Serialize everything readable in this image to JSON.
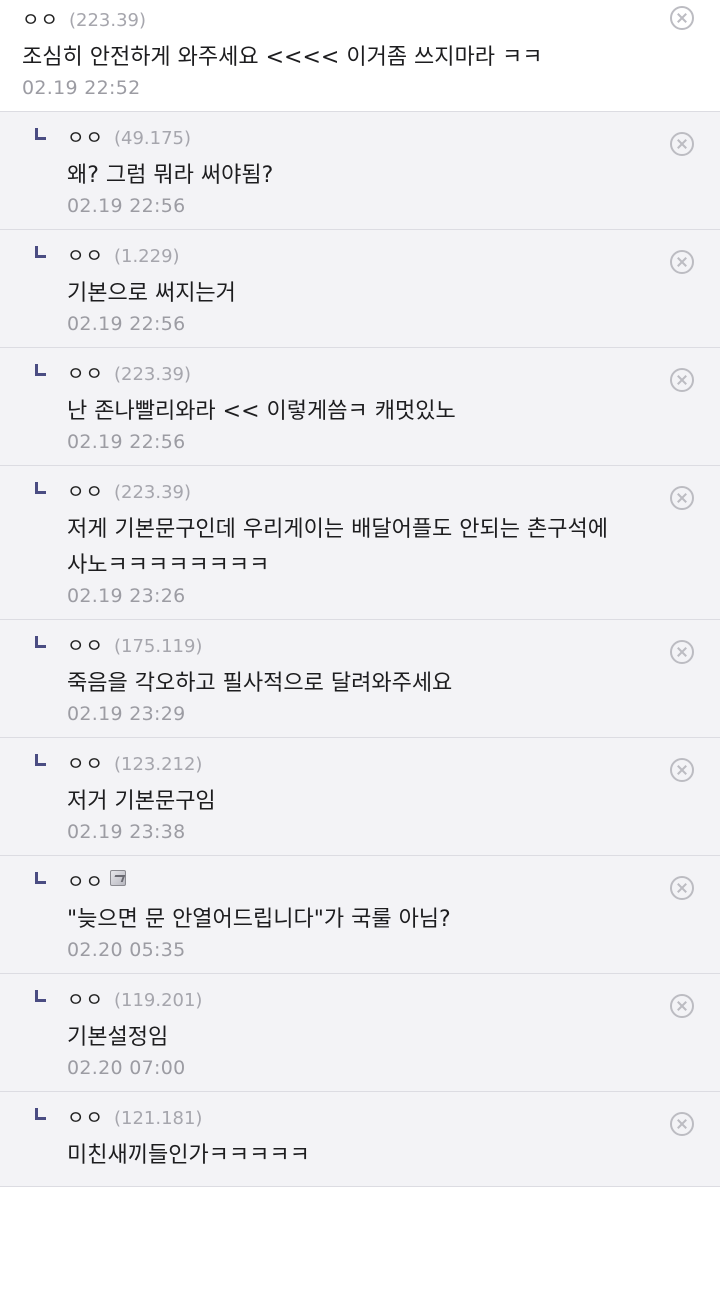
{
  "comments": [
    {
      "nick": "ㅇㅇ",
      "ip": "(223.39)",
      "text": "조심히 안전하게 와주세요 <<<< 이거좀 쓰지마라 ㅋㅋ",
      "date": "02.19 22:52",
      "reply": false
    },
    {
      "nick": "ㅇㅇ",
      "ip": "(49.175)",
      "text": "왜? 그럼 뭐라 써야됨?",
      "date": "02.19 22:56",
      "reply": true
    },
    {
      "nick": "ㅇㅇ",
      "ip": "(1.229)",
      "text": "기본으로 써지는거",
      "date": "02.19 22:56",
      "reply": true
    },
    {
      "nick": "ㅇㅇ",
      "ip": "(223.39)",
      "text": "난 존나빨리와라 << 이렇게씀ㅋ 캐멋있노",
      "date": "02.19 22:56",
      "reply": true
    },
    {
      "nick": "ㅇㅇ",
      "ip": "(223.39)",
      "text": "저게 기본문구인데 우리게이는 배달어플도 안되는 촌구석에 사노ㅋㅋㅋㅋㅋㅋㅋㅋ",
      "date": "02.19 23:26",
      "reply": true
    },
    {
      "nick": "ㅇㅇ",
      "ip": "(175.119)",
      "text": "죽음을 각오하고 필사적으로 달려와주세요",
      "date": "02.19 23:29",
      "reply": true
    },
    {
      "nick": "ㅇㅇ",
      "ip": "(123.212)",
      "text": "저거 기본문구임",
      "date": "02.19 23:38",
      "reply": true
    },
    {
      "nick": "ㅇㅇ",
      "ip": "",
      "member_icon": true,
      "text": "\"늦으면 문 안열어드립니다\"가 국룰 아님?",
      "date": "02.20 05:35",
      "reply": true
    },
    {
      "nick": "ㅇㅇ",
      "ip": "(119.201)",
      "text": "기본설정임",
      "date": "02.20 07:00",
      "reply": true
    },
    {
      "nick": "ㅇㅇ",
      "ip": "(121.181)",
      "text": "미친새끼들인가ㅋㅋㅋㅋㅋ",
      "date": "",
      "reply": true
    }
  ],
  "icons": {
    "delete": "circle-x-icon",
    "reply_marker": "reply-arrow-icon",
    "member": "fixed-nick-icon"
  },
  "colors": {
    "reply_bg": "#f3f3f6",
    "reply_marker": "#4a4c82",
    "meta_text": "#9c9ca3"
  }
}
